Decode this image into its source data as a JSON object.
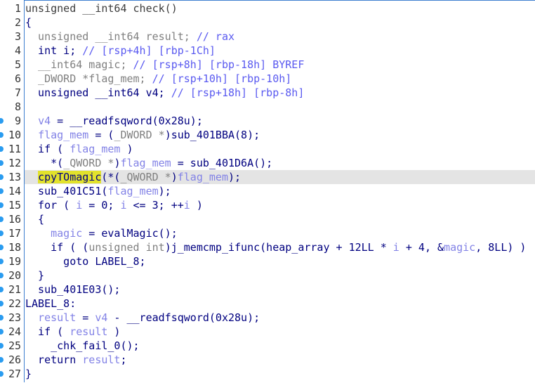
{
  "view": "pseudocode",
  "colors": {
    "keyword": "#000080",
    "variable": "#8282e6",
    "comment": "#5a5af0",
    "type_gray": "#808080",
    "current_line": "#e4e4e4",
    "highlight": "#e2e22c",
    "breakpoint_dot": "#2a9cf0"
  },
  "current_line": 13,
  "lines": [
    {
      "n": "1",
      "dot": false,
      "segs": [
        [
          "unsigned __int64 check()",
          "d"
        ]
      ]
    },
    {
      "n": "2",
      "dot": false,
      "segs": [
        [
          "{",
          "k"
        ]
      ]
    },
    {
      "n": "3",
      "dot": false,
      "segs": [
        [
          "  unsigned __int64 result; ",
          "g"
        ],
        [
          "// rax",
          "c"
        ]
      ]
    },
    {
      "n": "4",
      "dot": false,
      "segs": [
        [
          "  int i; ",
          "k"
        ],
        [
          "// [rsp+4h] [rbp-1Ch]",
          "c"
        ]
      ]
    },
    {
      "n": "5",
      "dot": false,
      "segs": [
        [
          "  __int64 magic; ",
          "g"
        ],
        [
          "// [rsp+8h] [rbp-18h] BYREF",
          "c"
        ]
      ]
    },
    {
      "n": "6",
      "dot": false,
      "segs": [
        [
          "  _DWORD *flag_mem; ",
          "g"
        ],
        [
          "// [rsp+10h] [rbp-10h]",
          "c"
        ]
      ]
    },
    {
      "n": "7",
      "dot": false,
      "segs": [
        [
          "  unsigned __int64 v4; ",
          "k"
        ],
        [
          "// [rsp+18h] [rbp-8h]",
          "c"
        ]
      ]
    },
    {
      "n": "8",
      "dot": false,
      "segs": [
        [
          "",
          "k"
        ]
      ]
    },
    {
      "n": "9",
      "dot": true,
      "segs": [
        [
          "  ",
          "k"
        ],
        [
          "v4",
          "v"
        ],
        [
          " = __readfsqword(0x28u);",
          "k"
        ]
      ]
    },
    {
      "n": "10",
      "dot": true,
      "segs": [
        [
          "  ",
          "k"
        ],
        [
          "flag_mem",
          "v"
        ],
        [
          " = (",
          "k"
        ],
        [
          "_DWORD *",
          "g"
        ],
        [
          ")sub_401BBA(8);",
          "k"
        ]
      ]
    },
    {
      "n": "11",
      "dot": true,
      "segs": [
        [
          "  if ( ",
          "k"
        ],
        [
          "flag_mem",
          "v"
        ],
        [
          " )",
          "k"
        ]
      ]
    },
    {
      "n": "12",
      "dot": true,
      "segs": [
        [
          "    *(",
          "k"
        ],
        [
          "_QWORD *",
          "g"
        ],
        [
          ")",
          "k"
        ],
        [
          "flag_mem",
          "v"
        ],
        [
          " = sub_401D6A();",
          "k"
        ]
      ]
    },
    {
      "n": "13",
      "dot": true,
      "segs": [
        [
          "  ",
          "k"
        ],
        [
          "cpyTOmagic",
          "y"
        ],
        [
          "(*(",
          "k"
        ],
        [
          "_QWORD *",
          "g"
        ],
        [
          ")",
          "k"
        ],
        [
          "flag_mem",
          "v"
        ],
        [
          ");",
          "k"
        ]
      ]
    },
    {
      "n": "14",
      "dot": true,
      "segs": [
        [
          "  sub_401C51(",
          "k"
        ],
        [
          "flag_mem",
          "v"
        ],
        [
          ");",
          "k"
        ]
      ]
    },
    {
      "n": "15",
      "dot": true,
      "segs": [
        [
          "  for ( ",
          "k"
        ],
        [
          "i",
          "v"
        ],
        [
          " = 0; ",
          "k"
        ],
        [
          "i",
          "v"
        ],
        [
          " <= 3; ++",
          "k"
        ],
        [
          "i",
          "v"
        ],
        [
          " )",
          "k"
        ]
      ]
    },
    {
      "n": "16",
      "dot": true,
      "segs": [
        [
          "  {",
          "k"
        ]
      ]
    },
    {
      "n": "17",
      "dot": true,
      "segs": [
        [
          "    ",
          "k"
        ],
        [
          "magic",
          "v"
        ],
        [
          " = evalMagic();",
          "k"
        ]
      ]
    },
    {
      "n": "18",
      "dot": true,
      "segs": [
        [
          "    if ( (",
          "k"
        ],
        [
          "unsigned int",
          "g"
        ],
        [
          ")j_memcmp_ifunc(heap_array + 12LL * ",
          "k"
        ],
        [
          "i",
          "v"
        ],
        [
          " + 4, &",
          "k"
        ],
        [
          "magic",
          "v"
        ],
        [
          ", 8LL) )",
          "k"
        ]
      ]
    },
    {
      "n": "19",
      "dot": true,
      "segs": [
        [
          "      goto LABEL_8;",
          "k"
        ]
      ]
    },
    {
      "n": "20",
      "dot": true,
      "segs": [
        [
          "  }",
          "k"
        ]
      ]
    },
    {
      "n": "21",
      "dot": true,
      "segs": [
        [
          "  sub_401E03();",
          "k"
        ]
      ]
    },
    {
      "n": "22",
      "dot": true,
      "segs": [
        [
          "LABEL_8:",
          "k"
        ]
      ]
    },
    {
      "n": "23",
      "dot": true,
      "segs": [
        [
          "  ",
          "k"
        ],
        [
          "result",
          "v"
        ],
        [
          " = ",
          "k"
        ],
        [
          "v4",
          "v"
        ],
        [
          " - __readfsqword(0x28u);",
          "k"
        ]
      ]
    },
    {
      "n": "24",
      "dot": true,
      "segs": [
        [
          "  if ( ",
          "k"
        ],
        [
          "result",
          "v"
        ],
        [
          " )",
          "k"
        ]
      ]
    },
    {
      "n": "25",
      "dot": true,
      "segs": [
        [
          "    _chk_fail_0();",
          "k"
        ]
      ]
    },
    {
      "n": "26",
      "dot": true,
      "segs": [
        [
          "  return ",
          "k"
        ],
        [
          "result",
          "v"
        ],
        [
          ";",
          "k"
        ]
      ]
    },
    {
      "n": "27",
      "dot": true,
      "segs": [
        [
          "}",
          "k"
        ]
      ]
    }
  ]
}
